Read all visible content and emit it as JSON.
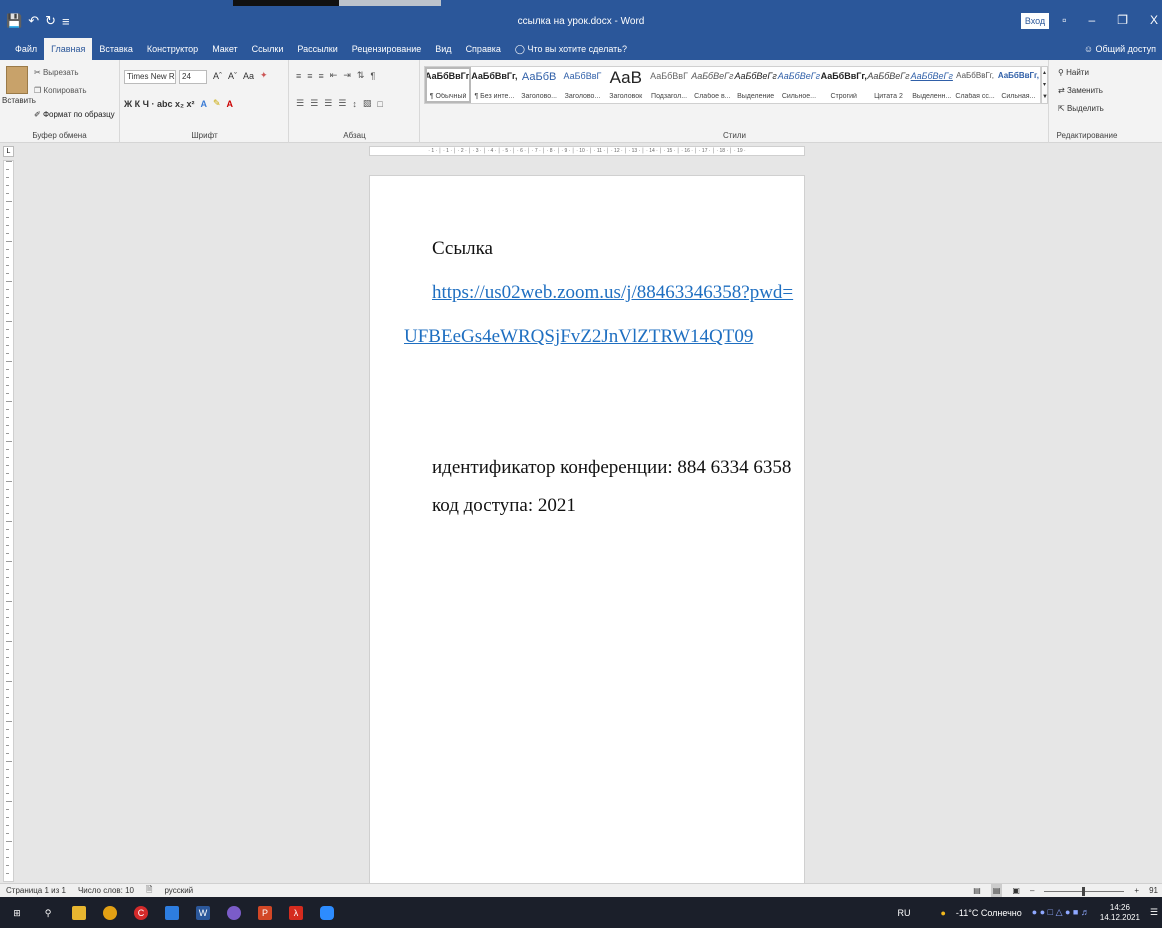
{
  "window": {
    "title": "ссылка на урок.docx  -  Word",
    "signin": "Вход",
    "quick_access": [
      "💾",
      "↶",
      "↻",
      "≡"
    ],
    "controls": [
      "▫",
      "–",
      "❐",
      "X"
    ]
  },
  "tabs": [
    "Файл",
    "Главная",
    "Вставка",
    "Конструктор",
    "Макет",
    "Ссылки",
    "Рассылки",
    "Рецензирование",
    "Вид",
    "Справка"
  ],
  "tell_me": "Что вы хотите сделать?",
  "share": "Общий доступ",
  "ribbon": {
    "clipboard": {
      "paste": "Вставить",
      "cut": "Вырезать",
      "copy": "Копировать",
      "format_painter": "Формат по образцу",
      "label": "Буфер обмена"
    },
    "font": {
      "name": "Times New R",
      "size": "24",
      "label": "Шрифт",
      "row2": "Ж  К  Ч  ·  abc  x₂  x²"
    },
    "paragraph": {
      "label": "Абзац"
    },
    "styles": {
      "label": "Стили",
      "items": [
        {
          "sample": "АаБбВвГг,",
          "name": "¶ Обычный"
        },
        {
          "sample": "АаБбВвГг,",
          "name": "¶ Без инте..."
        },
        {
          "sample": "АаБбВ",
          "name": "Заголово..."
        },
        {
          "sample": "АаБбВвГ",
          "name": "Заголово..."
        },
        {
          "sample": "АаВ",
          "name": "Заголовок"
        },
        {
          "sample": "АаБбВвГ",
          "name": "Подзагол..."
        },
        {
          "sample": "АаБбВеГг",
          "name": "Слабое в..."
        },
        {
          "sample": "АаБбВеГг",
          "name": "Выделение"
        },
        {
          "sample": "АаБбВеГг",
          "name": "Сильное..."
        },
        {
          "sample": "АаБбВвГг,",
          "name": "Строгий"
        },
        {
          "sample": "АаБбВеГг",
          "name": "Цитата 2"
        },
        {
          "sample": "АаБбВеГг",
          "name": "Выделенн..."
        },
        {
          "sample": "АаБбВвГг,",
          "name": "Слабая сс..."
        },
        {
          "sample": "АаБбВвГг,",
          "name": "Сильная..."
        }
      ]
    },
    "editing": {
      "find": "Найти",
      "replace": "Заменить",
      "select": "Выделить",
      "label": "Редактирование"
    }
  },
  "ruler": "· 1 · │ · 1 · │ · 2 · │ · 3 · │ · 4 · │ · 5 · │ · 6 · │ · 7 · │ · 8 · │ · 9 · │ · 10 · │ · 11 · │ · 12 · │ · 13 · │ · 14 · │ · 15 · │ · 16 · │ · 17 · │ · 18 · │ · 19 ·",
  "document": {
    "heading": "Ссылка",
    "link_line1": "https://us02web.zoom.us/j/88463346358?pwd=",
    "link_line2": "UFBEeGs4eWRQSjFvZ2JnVlZTRW14QT09",
    "conference_id": "идентификатор конференции: 884 6334 6358",
    "access_code": "код доступа: 2021"
  },
  "status": {
    "page": "Страница 1 из 1",
    "words": "Число слов: 10",
    "language": "русский",
    "zoom": "91"
  },
  "taskbar": {
    "lang": "RU",
    "weather": "-11°C Солнечно",
    "time": "14:26",
    "date": "14.12.2021"
  }
}
